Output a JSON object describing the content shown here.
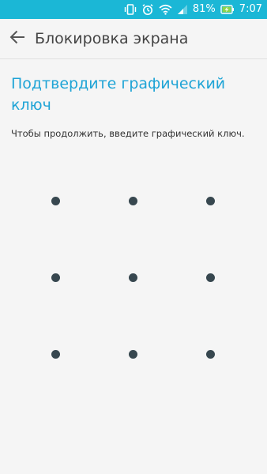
{
  "status_bar": {
    "battery_percent": "81%",
    "time": "7:07",
    "background_color": "#1bb7d6",
    "icons": [
      "vibrate-icon",
      "alarm-icon",
      "wifi-icon",
      "signal-icon",
      "battery-charging-icon"
    ]
  },
  "toolbar": {
    "title": "Блокировка экрана",
    "back_icon": "arrow-back-icon"
  },
  "screen": {
    "heading": "Подтвердите графический ключ",
    "instruction": "Чтобы продолжить, введите графический ключ.",
    "heading_color": "#1fa4d6"
  },
  "pattern": {
    "rows": 3,
    "columns": 3,
    "dot_color": "#37474f"
  }
}
